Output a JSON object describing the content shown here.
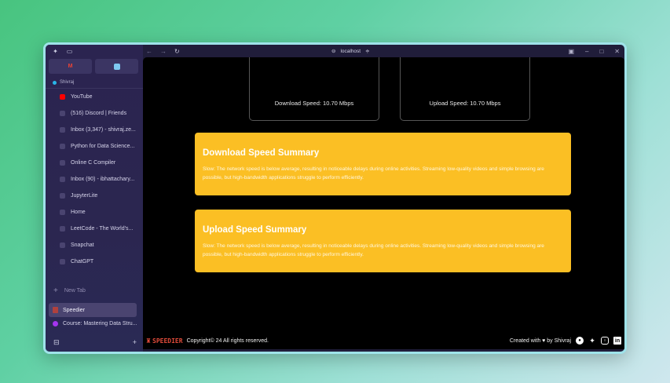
{
  "browser": {
    "url": "localhost",
    "profile": "Shivraj",
    "new_tab": "New Tab",
    "tabs": [
      {
        "label": "YouTube",
        "icon": "youtube-icon"
      },
      {
        "label": "(516) Discord | Friends",
        "icon": "discord-icon"
      },
      {
        "label": "Inbox (3,347) - shivraj.ze...",
        "icon": "gmail-icon"
      },
      {
        "label": "Python for Data Science...",
        "icon": "page-icon"
      },
      {
        "label": "Online C Compiler",
        "icon": "page-icon"
      },
      {
        "label": "Inbox (90) - ibhattachary...",
        "icon": "gmail-icon"
      },
      {
        "label": "JupyterLite",
        "icon": "jupyter-icon"
      },
      {
        "label": "Home",
        "icon": "page-icon"
      },
      {
        "label": "LeetCode - The World's...",
        "icon": "leetcode-icon"
      },
      {
        "label": "Snapchat",
        "icon": "snapchat-icon"
      },
      {
        "label": "ChatGPT",
        "icon": "chatgpt-icon"
      }
    ],
    "active_tab": "Speedier",
    "extra_tab": "Course: Mastering Data Stru..."
  },
  "gauges": {
    "download": "Download Speed: 10.70 Mbps",
    "upload": "Upload Speed: 10.70 Mbps"
  },
  "summaries": {
    "download_title": "Download Speed Summary",
    "download_text": "Slow: The network speed is below average, resulting in noticeable delays during online activities. Streaming low-quality videos and simple browsing are possible, but high-bandwidth applications struggle to perform efficiently.",
    "upload_title": "Upload Speed Summary",
    "upload_text": "Slow: The network speed is below average, resulting in noticeable delays during online activities. Streaming low-quality videos and simple browsing are possible, but high-bandwidth applications struggle to perform efficiently."
  },
  "footer": {
    "logo": "SPEEDIER",
    "copyright": "Copyright© 24 All rights reserved.",
    "credit": "Created with ♥ by Shivraj"
  },
  "colors": {
    "accent": "#fbbf24",
    "logo": "#e04b3a",
    "sidebar": "#2b2450"
  }
}
